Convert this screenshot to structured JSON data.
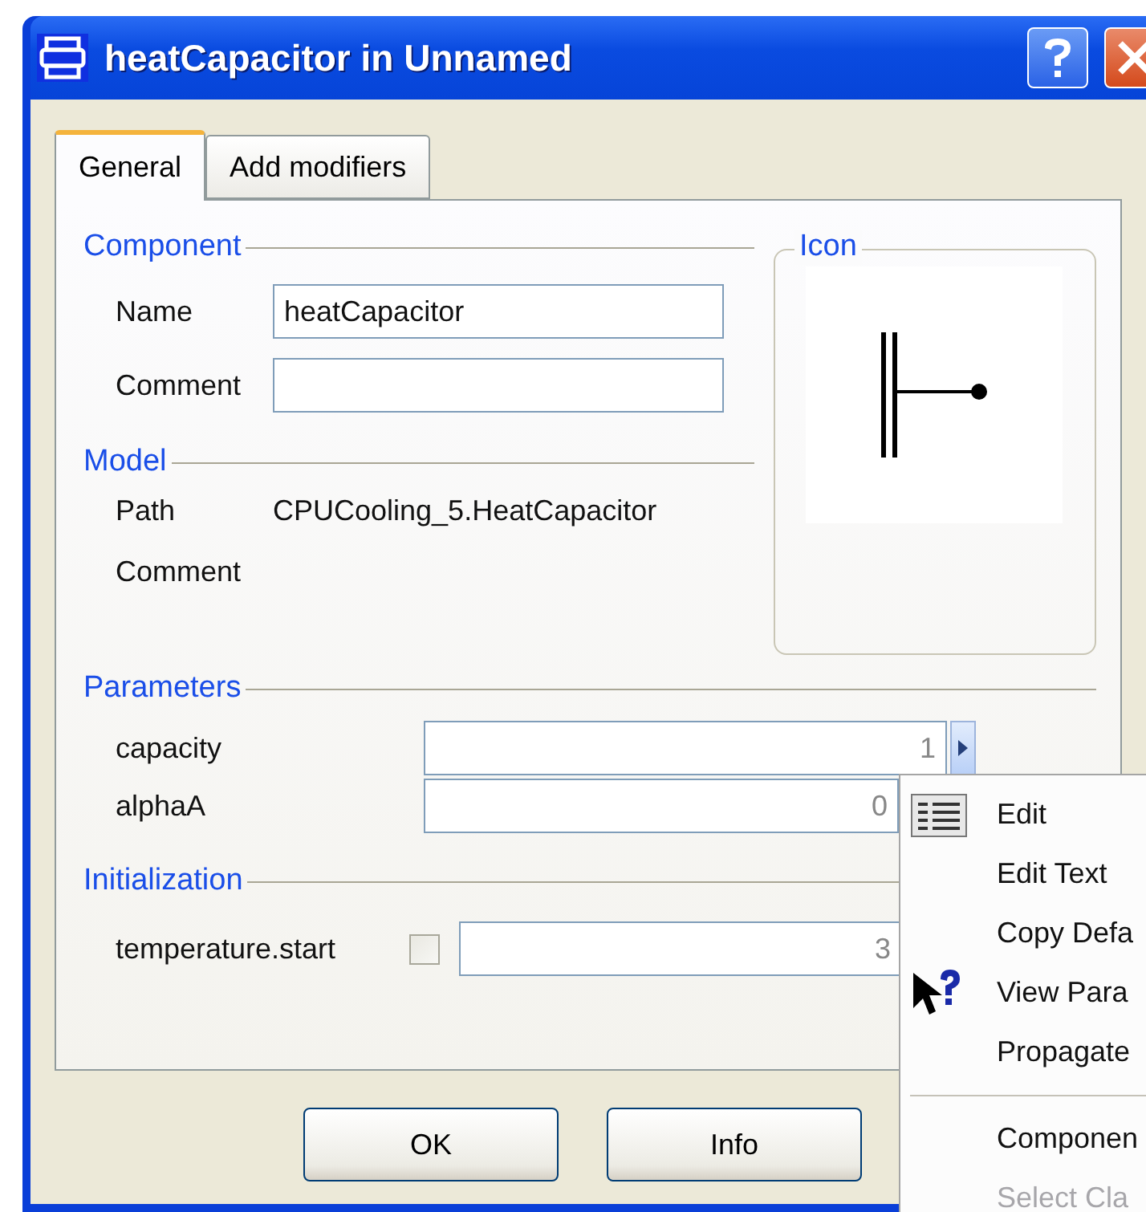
{
  "window": {
    "title": "heatCapacitor in Unnamed"
  },
  "tabs": [
    {
      "label": "General",
      "selected": true
    },
    {
      "label": "Add modifiers",
      "selected": false
    }
  ],
  "component": {
    "title": "Component",
    "fields": [
      {
        "label": "Name",
        "value": "heatCapacitor"
      },
      {
        "label": "Comment"
      }
    ]
  },
  "icon_group": {
    "title": "Icon"
  },
  "model": {
    "title": "Model",
    "rows": [
      {
        "label": "Path",
        "value": "CPUCooling_5.HeatCapacitor"
      },
      {
        "label": "Comment"
      }
    ]
  },
  "parameters": {
    "title": "Parameters",
    "rows": [
      {
        "label": "capacity",
        "placeholder": "1",
        "kind": "menu"
      },
      {
        "label": "alphaA",
        "placeholder": "0",
        "kind": "plain"
      }
    ]
  },
  "initialization": {
    "title": "Initialization",
    "rows": [
      {
        "label": "temperature.start",
        "placeholder": "3",
        "checked": false
      }
    ]
  },
  "buttons": [
    "OK",
    "Info"
  ],
  "context_menu": {
    "items": [
      {
        "kind": "table",
        "label": "Edit",
        "disabled": false
      },
      {
        "kind": "plain",
        "label": "Edit Text",
        "disabled": false
      },
      {
        "kind": "plain",
        "label": "Copy Defa",
        "disabled": false
      },
      {
        "kind": "help",
        "label": "View Para",
        "disabled": false
      },
      {
        "kind": "plain",
        "label": "Propagate",
        "disabled": false
      },
      {
        "kind": "separator"
      },
      {
        "kind": "plain",
        "label": "Componen",
        "disabled": false
      },
      {
        "kind": "plain",
        "label": "Select Cla",
        "disabled": true
      }
    ]
  }
}
